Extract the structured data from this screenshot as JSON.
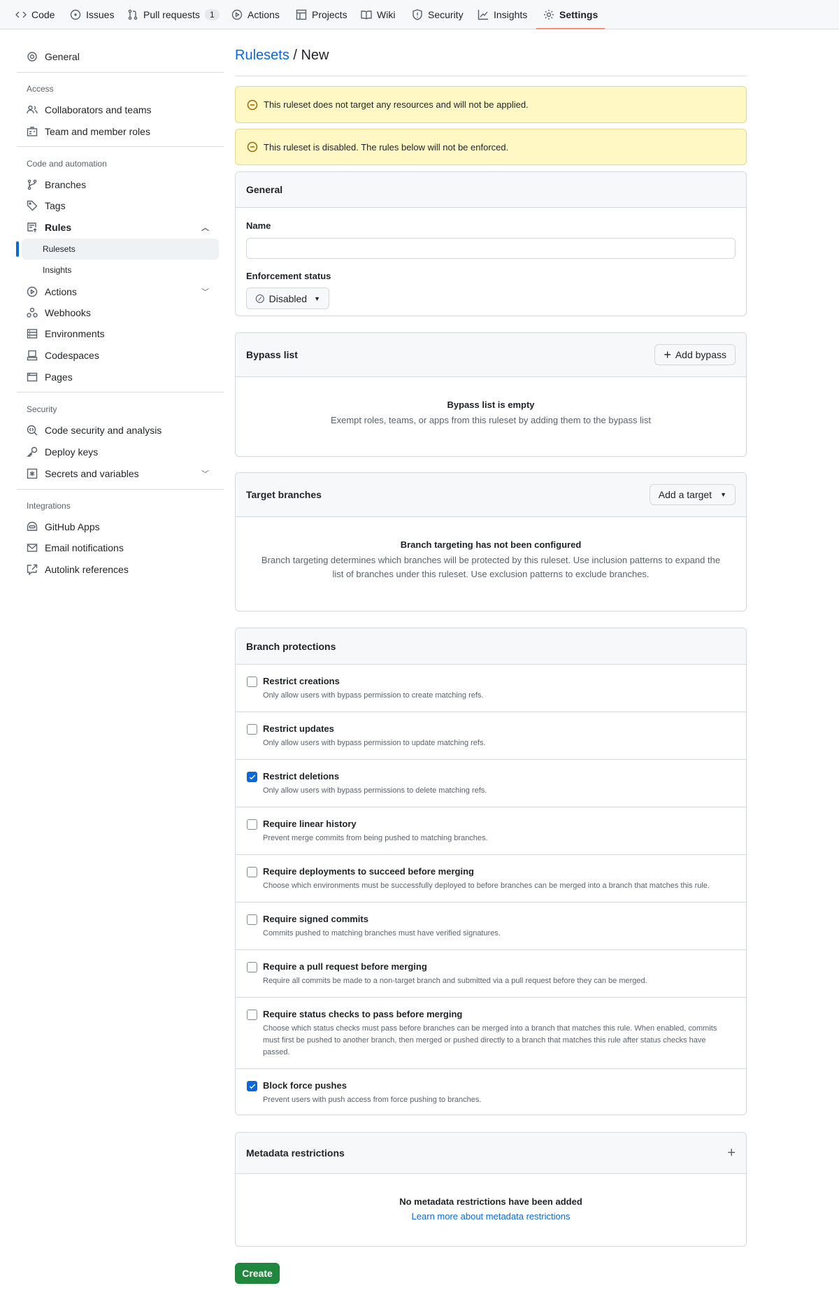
{
  "nav": {
    "tabs": [
      {
        "label": "Code",
        "icon": "code-icon"
      },
      {
        "label": "Issues",
        "icon": "issue-icon"
      },
      {
        "label": "Pull requests",
        "icon": "pull-request-icon",
        "count": "1"
      },
      {
        "label": "Actions",
        "icon": "play-icon"
      },
      {
        "label": "Projects",
        "icon": "table-icon"
      },
      {
        "label": "Wiki",
        "icon": "book-icon"
      },
      {
        "label": "Security",
        "icon": "shield-icon"
      },
      {
        "label": "Insights",
        "icon": "graph-icon"
      },
      {
        "label": "Settings",
        "icon": "gear-icon",
        "active": true
      }
    ]
  },
  "sidebar": {
    "general": "General",
    "access": {
      "heading": "Access",
      "items": [
        "Collaborators and teams",
        "Team and member roles"
      ]
    },
    "code": {
      "heading": "Code and automation",
      "items": [
        "Branches",
        "Tags",
        "Rules",
        "Rulesets",
        "Insights",
        "Actions",
        "Webhooks",
        "Environments",
        "Codespaces",
        "Pages"
      ]
    },
    "security": {
      "heading": "Security",
      "items": [
        "Code security and analysis",
        "Deploy keys",
        "Secrets and variables"
      ]
    },
    "integrations": {
      "heading": "Integrations",
      "items": [
        "GitHub Apps",
        "Email notifications",
        "Autolink references"
      ]
    },
    "selected": "Rulesets"
  },
  "header": {
    "link": "Rulesets",
    "separator": " / ",
    "current": "New"
  },
  "alerts": [
    "This ruleset does not target any resources and will not be applied.",
    "This ruleset is disabled. The rules below will not be enforced."
  ],
  "general": {
    "title": "General",
    "name_label": "Name",
    "name_value": "",
    "enforcement_label": "Enforcement status",
    "enforcement_value": "Disabled"
  },
  "bypass": {
    "title": "Bypass list",
    "button": "Add bypass",
    "empty_title": "Bypass list is empty",
    "empty_text": "Exempt roles, teams, or apps from this ruleset by adding them to the bypass list"
  },
  "targets": {
    "title": "Target branches",
    "button": "Add a target",
    "empty_title": "Branch targeting has not been configured",
    "empty_text": "Branch targeting determines which branches will be protected by this ruleset. Use inclusion patterns to expand the list of branches under this ruleset. Use exclusion patterns to exclude branches."
  },
  "protections": {
    "title": "Branch protections",
    "rules": [
      {
        "title": "Restrict creations",
        "desc": "Only allow users with bypass permission to create matching refs.",
        "checked": false
      },
      {
        "title": "Restrict updates",
        "desc": "Only allow users with bypass permission to update matching refs.",
        "checked": false
      },
      {
        "title": "Restrict deletions",
        "desc": "Only allow users with bypass permissions to delete matching refs.",
        "checked": true
      },
      {
        "title": "Require linear history",
        "desc": "Prevent merge commits from being pushed to matching branches.",
        "checked": false
      },
      {
        "title": "Require deployments to succeed before merging",
        "desc": "Choose which environments must be successfully deployed to before branches can be merged into a branch that matches this rule.",
        "checked": false
      },
      {
        "title": "Require signed commits",
        "desc": "Commits pushed to matching branches must have verified signatures.",
        "checked": false
      },
      {
        "title": "Require a pull request before merging",
        "desc": "Require all commits be made to a non-target branch and submitted via a pull request before they can be merged.",
        "checked": false
      },
      {
        "title": "Require status checks to pass before merging",
        "desc": "Choose which status checks must pass before branches can be merged into a branch that matches this rule. When enabled, commits must first be pushed to another branch, then merged or pushed directly to a branch that matches this rule after status checks have passed.",
        "checked": false
      },
      {
        "title": "Block force pushes",
        "desc": "Prevent users with push access from force pushing to branches.",
        "checked": true
      }
    ]
  },
  "metadata": {
    "title": "Metadata restrictions",
    "empty_title": "No metadata restrictions have been added",
    "link": "Learn more about metadata restrictions"
  },
  "create_button": "Create",
  "colors": {
    "accent": "#0969da",
    "primary_button": "#1f883d",
    "alert_bg": "#fff8c5",
    "tab_underline": "#fd8c73"
  }
}
